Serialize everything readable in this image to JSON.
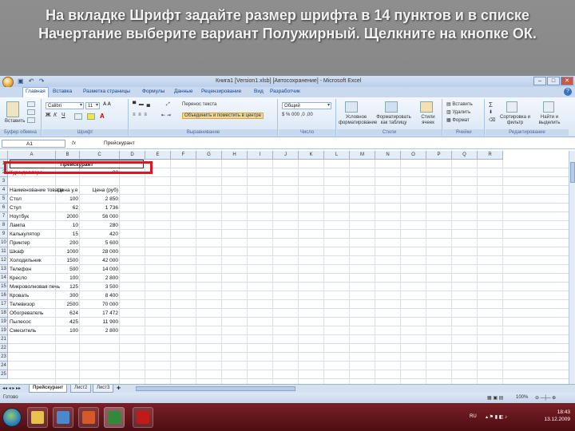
{
  "slide": {
    "title": "На вкладке Шрифт задайте размер шрифта в 14 пунктов и в списке Начертание выберите вариант Полужирный. Щелкните на кнопке ОК."
  },
  "window": {
    "title": "Книга1 [Version1.xlsb] [Автосохранение] - Microsoft Excel",
    "qat": "▣ ↶ ↷"
  },
  "tabs": [
    "Главная",
    "Вставка",
    "Разметка страницы",
    "Формулы",
    "Данные",
    "Рецензирование",
    "Вид",
    "Разработчик"
  ],
  "ribbon": {
    "clipboard": {
      "paste": "Вставить",
      "label": "Буфер обмена"
    },
    "font": {
      "name": "Calibri",
      "size": "11",
      "label": "Шрифт"
    },
    "alignment": {
      "wrap": "Перенос текста",
      "merge": "Объединить и поместить в центре",
      "label": "Выравнивание"
    },
    "number": {
      "format": "Общий",
      "label": "Число"
    },
    "styles": {
      "conditional": "Условное форматирование",
      "table": "Форматировать как таблицу",
      "cell": "Стили ячеек",
      "label": "Стили"
    },
    "cells": {
      "insert": "Вставить",
      "delete": "Удалить",
      "format": "Формат",
      "label": "Ячейки"
    },
    "editing": {
      "sort": "Сортировка и фильтр",
      "find": "Найти и выделить",
      "label": "Редактирование"
    }
  },
  "formula_bar": {
    "cell_ref": "A1",
    "fx": "fx",
    "content": "Прейскурант"
  },
  "grid": {
    "columns": [
      "A",
      "B",
      "C",
      "D",
      "E",
      "F",
      "G",
      "H",
      "I",
      "J",
      "K",
      "L",
      "M",
      "N",
      "O",
      "P",
      "Q",
      "R"
    ],
    "rows": [
      [
        "1",
        "Прейскурант",
        "",
        ""
      ],
      [
        "2",
        "Курс доллара",
        "",
        "28"
      ],
      [
        "3",
        "",
        "",
        ""
      ],
      [
        "4",
        "Наименование товара",
        "Цена у.е.",
        "Цена (руб)"
      ],
      [
        "5",
        "Стол",
        "100",
        "2 850"
      ],
      [
        "6",
        "Стул",
        "62",
        "1 736"
      ],
      [
        "7",
        "Ноутбук",
        "2000",
        "56 000"
      ],
      [
        "8",
        "Лампа",
        "10",
        "280"
      ],
      [
        "9",
        "Калькулятор",
        "15",
        "420"
      ],
      [
        "10",
        "Принтер",
        "200",
        "5 600"
      ],
      [
        "11",
        "Шкаф",
        "1000",
        "28 000"
      ],
      [
        "12",
        "Холодильник",
        "1500",
        "42 000"
      ],
      [
        "13",
        "Телефон",
        "500",
        "14 000"
      ],
      [
        "14",
        "Кресло",
        "100",
        "2 800"
      ],
      [
        "15",
        "Микроволновая печь",
        "125",
        "3 500"
      ],
      [
        "16",
        "Кровать",
        "300",
        "8 400"
      ],
      [
        "17",
        "Телевизор",
        "2500",
        "70 000"
      ],
      [
        "18",
        "Обогреватель",
        "624",
        "17 472"
      ],
      [
        "19",
        "Пылесос",
        "425",
        "11 900"
      ],
      [
        "19",
        "Смеситель",
        "100",
        "2 800"
      ],
      [
        "21",
        "",
        "",
        ""
      ],
      [
        "22",
        "",
        "",
        ""
      ],
      [
        "23",
        "",
        "",
        ""
      ],
      [
        "24",
        "",
        "",
        ""
      ],
      [
        "25",
        "",
        "",
        ""
      ]
    ]
  },
  "sheets": [
    "Прейскурант",
    "Лист2",
    "Лист3"
  ],
  "status": {
    "ready": "Готово",
    "zoom": "100%"
  },
  "taskbar": {
    "lang": "RU",
    "time": "18:43",
    "date": "13.12.2009"
  },
  "colors": {
    "highlight": "#e0141e",
    "taskbar": "#6a151c"
  }
}
